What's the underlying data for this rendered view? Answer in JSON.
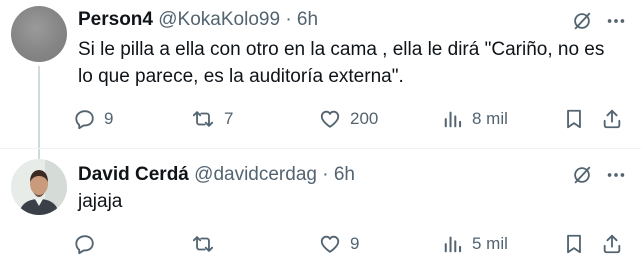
{
  "tweets": [
    {
      "name": "Person4",
      "handle": "@KokaKolo99",
      "separator": "·",
      "time": "6h",
      "text": "Si le pilla a ella con otro en la cama , ella le dirá \"Cariño, no es lo que parece, es la auditoría externa\".",
      "avatar": "grey-placeholder-avatar",
      "actions": {
        "replies": "9",
        "reposts": "7",
        "likes": "200",
        "views": "8 mil"
      }
    },
    {
      "name": "David Cerdá",
      "handle": "@davidcerdag",
      "separator": "·",
      "time": "6h",
      "text": "jajaja",
      "avatar": "photo-avatar",
      "actions": {
        "replies": "",
        "reposts": "",
        "likes": "9",
        "views": "5 mil"
      }
    }
  ],
  "icons": {
    "reply": "reply-icon",
    "repost": "repost-icon",
    "like": "heart-icon",
    "views": "views-icon",
    "bookmark": "bookmark-icon",
    "share": "share-icon",
    "grok": "grok-icon",
    "more": "more-icon"
  },
  "colors": {
    "text": "#0f1419",
    "secondary": "#536471",
    "thread_line": "#cfd9de"
  }
}
